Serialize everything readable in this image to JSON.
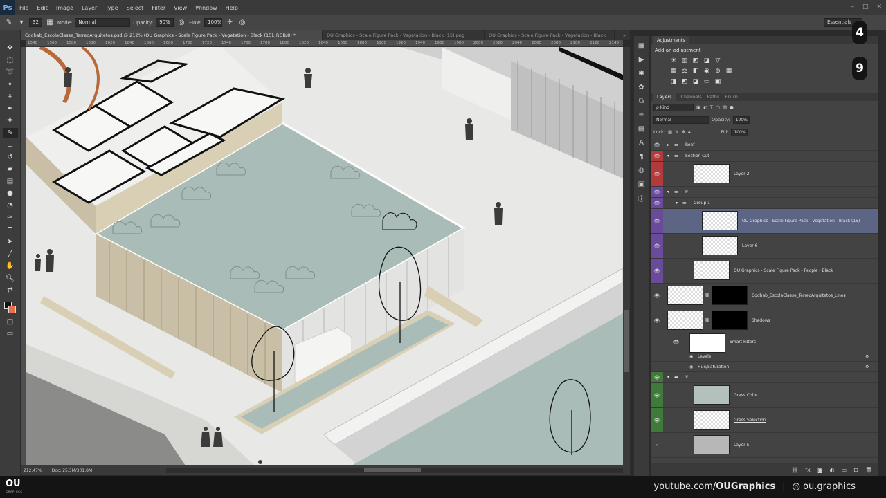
{
  "app": {
    "logo": "Ps"
  },
  "menu": [
    "File",
    "Edit",
    "Image",
    "Layer",
    "Type",
    "Select",
    "Filter",
    "View",
    "Window",
    "Help"
  ],
  "options": {
    "brush_size": "32",
    "mode_label": "Mode:",
    "mode_value": "Normal",
    "opacity_label": "Opacity:",
    "opacity_value": "90%",
    "flow_label": "Flow:",
    "flow_value": "100%",
    "workspace": "Essentials"
  },
  "tabs": [
    "Codhab_EscolaClasse_TerreoArquitetos.psd @ 212% (OU Graphics - Scale Figure Pack - Vegetation - Black (15), RGB/8) *",
    "OU Graphics - Scale Figure Pack - Vegetation - Black (15).png",
    "OU Graphics - Scale Figure Pack - Vegetation - Black"
  ],
  "ruler_ticks": [
    "1540",
    "1560",
    "1580",
    "1600",
    "1620",
    "1640",
    "1660",
    "1680",
    "1700",
    "1720",
    "1740",
    "1760",
    "1780",
    "1800",
    "1820",
    "1840",
    "1860",
    "1880",
    "1900",
    "1920",
    "1940",
    "1960",
    "1980",
    "2000",
    "2020",
    "2040",
    "2060",
    "2080",
    "2100",
    "2120",
    "2140"
  ],
  "status": {
    "zoom": "212.47%",
    "doc": "Doc: 25.3M/301.8M"
  },
  "adjustments": {
    "tab": "Adjustments",
    "title": "Add an adjustment"
  },
  "layers_panel": {
    "tabs": [
      "Layers",
      "Channels",
      "Paths",
      "Brush"
    ],
    "filter_kind": "Kind",
    "blend_mode": "Normal",
    "opacity_label": "Opacity:",
    "opacity_value": "100%",
    "lock_label": "Lock:",
    "fill_label": "Fill:",
    "fill_value": "100%",
    "color_codes": {
      "red": "#b33a3a",
      "purple": "#6a4a9a",
      "green": "#3f7a3a"
    },
    "layers": [
      {
        "name": "Roof",
        "kind": "group",
        "indent": 0
      },
      {
        "name": "Section Cut",
        "kind": "group",
        "indent": 0,
        "color": "red"
      },
      {
        "name": "Layer 2",
        "kind": "layer",
        "indent": 1,
        "color": "red"
      },
      {
        "name": "P",
        "kind": "group",
        "indent": 0,
        "color": "purple"
      },
      {
        "name": "Group 1",
        "kind": "group",
        "indent": 1,
        "color": "purple"
      },
      {
        "name": "OU Graphics - Scale Figure Pack - Vegetation - Black (15)",
        "kind": "layer",
        "indent": 2,
        "color": "purple",
        "selected": true
      },
      {
        "name": "Layer 6",
        "kind": "layer",
        "indent": 2,
        "color": "purple"
      },
      {
        "name": "OU Graphics - Scale Figure Pack - People - Black",
        "kind": "layer",
        "indent": 1,
        "color": "purple"
      },
      {
        "name": "Codhab_EscolaClasse_TerreoArquitetos_Lines",
        "kind": "masked",
        "indent": 0
      },
      {
        "name": "Shadows",
        "kind": "masked",
        "indent": 0
      },
      {
        "name": "Smart Filters",
        "kind": "filter",
        "indent": 1
      },
      {
        "name": "Levels",
        "kind": "effect",
        "indent": 1
      },
      {
        "name": "Hue/Saturation",
        "kind": "effect",
        "indent": 1
      },
      {
        "name": "V",
        "kind": "group",
        "indent": 0,
        "color": "green"
      },
      {
        "name": "Grass Color",
        "kind": "fill",
        "indent": 1,
        "color": "green"
      },
      {
        "name": "Grass Selection",
        "kind": "layer",
        "indent": 1,
        "color": "green"
      },
      {
        "name": "Layer 5",
        "kind": "gray",
        "indent": 1
      }
    ]
  },
  "overlay_badges": [
    "4",
    "9"
  ],
  "brand": {
    "logo": "OU",
    "logo_sub": "GRAPHICS",
    "youtube_prefix": "youtube.com/",
    "youtube_channel": "OUGraphics",
    "instagram": "ou.graphics"
  }
}
